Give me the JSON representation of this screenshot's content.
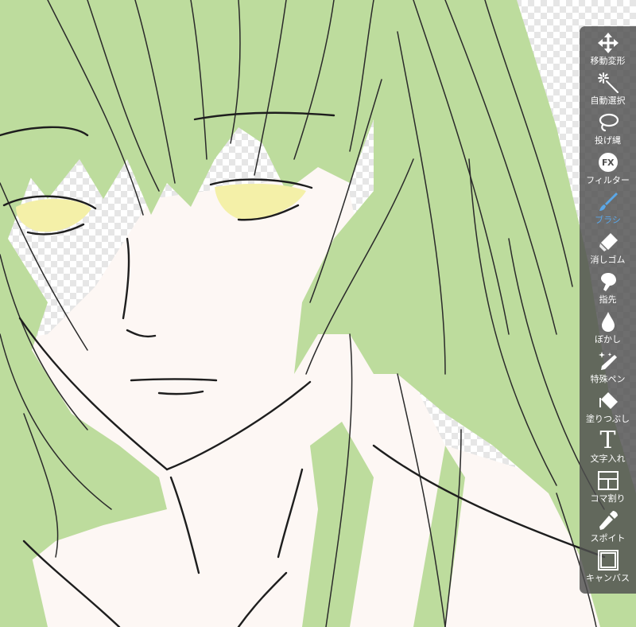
{
  "colors": {
    "toolbar_bg": "rgba(78,78,78,0.82)",
    "label": "#ffffff",
    "active_label": "#5aa7e8",
    "hair": "#bddc9d",
    "skin": "#fdf7f4",
    "eyes": "#f4f0a8",
    "line": "#1e1e1e"
  },
  "toolbar": {
    "tools": [
      {
        "label": "移動変形",
        "icon": "move-arrows-icon",
        "active": false
      },
      {
        "label": "自動選択",
        "icon": "magic-wand-icon",
        "active": false
      },
      {
        "label": "投げ縄",
        "icon": "lasso-icon",
        "active": false
      },
      {
        "label": "フィルター",
        "icon": "fx-icon",
        "icon_text": "FX",
        "active": false
      },
      {
        "label": "ブラシ",
        "icon": "brush-icon",
        "active": true
      },
      {
        "label": "消しゴム",
        "icon": "eraser-icon",
        "active": false
      },
      {
        "label": "指先",
        "icon": "finger-smudge-icon",
        "active": false
      },
      {
        "label": "ぼかし",
        "icon": "blur-drop-icon",
        "active": false
      },
      {
        "label": "特殊ペン",
        "icon": "special-pen-icon",
        "active": false
      },
      {
        "label": "塗りつぶし",
        "icon": "fill-bucket-icon",
        "active": false
      },
      {
        "label": "文字入れ",
        "icon": "text-icon",
        "icon_text": "T",
        "active": false
      },
      {
        "label": "コマ割り",
        "icon": "panel-divide-icon",
        "active": false
      },
      {
        "label": "スポイト",
        "icon": "eyedropper-icon",
        "active": false
      },
      {
        "label": "キャンバス",
        "icon": "canvas-icon",
        "active": false
      }
    ]
  }
}
